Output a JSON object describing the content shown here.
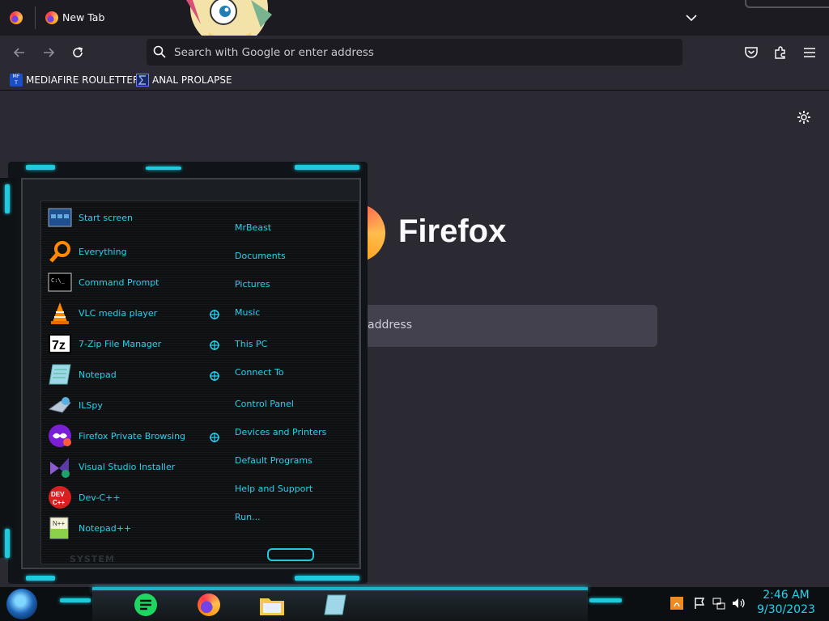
{
  "browser": {
    "tab_title": "New Tab",
    "url_placeholder": "Search with Google or enter address",
    "bookmarks": [
      {
        "label": "MEDIAFIRE ROULETTER",
        "icon": "mediafire-icon"
      },
      {
        "label": "ANAL PROLAPSE",
        "icon": "sigma-icon"
      }
    ],
    "brand": "Firefox",
    "search_hint": "address"
  },
  "start_menu": {
    "left_items": [
      {
        "label": "Start screen",
        "icon": "start-screen-icon"
      },
      {
        "label": "Everything",
        "icon": "magnifier-icon"
      },
      {
        "label": "Command Prompt",
        "icon": "cmd-icon"
      },
      {
        "label": "VLC media player",
        "icon": "vlc-cone-icon"
      },
      {
        "label": "7-Zip File Manager",
        "icon": "7zip-icon"
      },
      {
        "label": "Notepad",
        "icon": "notepad-icon"
      },
      {
        "label": "ILSpy",
        "icon": "ilspy-icon"
      },
      {
        "label": "Firefox Private Browsing",
        "icon": "private-browsing-icon"
      },
      {
        "label": "Visual Studio Installer",
        "icon": "visual-studio-icon"
      },
      {
        "label": "Dev-C++",
        "icon": "devcpp-icon"
      },
      {
        "label": "Notepad++",
        "icon": "notepadpp-icon"
      }
    ],
    "right_items": [
      "MrBeast",
      "Documents",
      "Pictures",
      "Music",
      "This PC",
      "Connect To",
      "Control Panel",
      "Devices and Printers",
      "Default Programs",
      "Help and Support",
      "Run..."
    ],
    "footer": "SYSTEM"
  },
  "taskbar": {
    "apps": [
      "notes-app-icon",
      "firefox-icon",
      "file-explorer-icon",
      "notepad-icon"
    ],
    "time": "2:46 AM",
    "date": "9/30/2023"
  },
  "colors": {
    "accent_cyan": "#22d3ee",
    "browser_bg": "#2b2a33"
  }
}
